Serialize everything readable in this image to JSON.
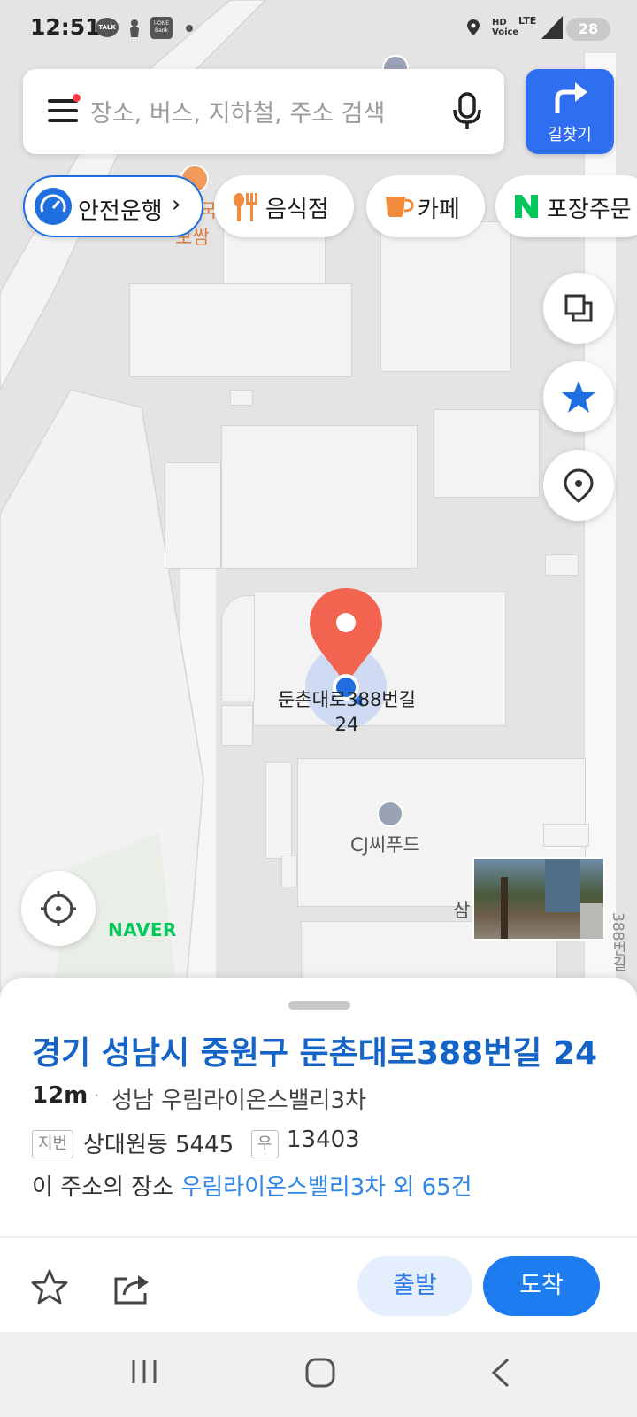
{
  "status_bar": {
    "time": "12:51",
    "talk_icon": "TALK",
    "bank_icon": "i-ONE Bank",
    "hd_voice": "HD Voice",
    "network": "LTE",
    "battery": "28"
  },
  "search": {
    "placeholder": "장소, 버스, 지하철, 주소 검색",
    "route_label": "길찾기"
  },
  "chips": [
    {
      "label": "안전운행",
      "suffix": "›",
      "icon": "speedometer-icon",
      "color": "#1f6fe0"
    },
    {
      "label": "음식점",
      "icon": "fork-knife-icon",
      "color": "#f08a3c"
    },
    {
      "label": "카페",
      "icon": "coffee-cup-icon",
      "color": "#f08a3c"
    },
    {
      "label": "포장주문",
      "icon": "naver-n-icon",
      "color": "#03c75a"
    }
  ],
  "map": {
    "pin_label_line1": "둔촌대로388번길",
    "pin_label_line2": "24",
    "poi": "CJ씨푸드",
    "poi_partial_top": "국",
    "poi_partial_top2": "보쌈",
    "partial_label": "삼",
    "road_label": "388번길",
    "brand": "NAVER"
  },
  "sheet": {
    "address": "경기 성남시 중원구 둔촌대로388번길 24",
    "distance": "12m",
    "separator": "·",
    "building": "성남 우림라이온스밸리3차",
    "jibun_tag": "지번",
    "jibun_value": "상대원동 5445",
    "postal_tag": "우",
    "postal_value": "13403",
    "places_prefix": "이 주소의 장소",
    "places_link": "우림라이온스밸리3차 외 65건",
    "depart_label": "출발",
    "arrive_label": "도착"
  },
  "colors": {
    "accent": "#1c7cf0",
    "address": "#1464c8",
    "pin": "#f26350",
    "naver_green": "#03c75a"
  }
}
